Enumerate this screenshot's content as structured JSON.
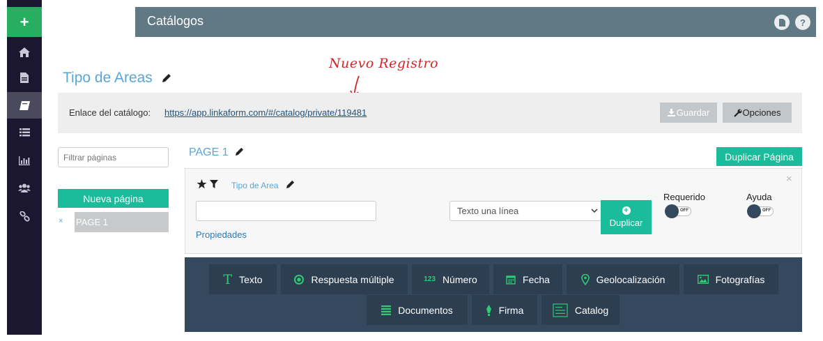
{
  "topbar": {
    "title": "Catálogos",
    "icons": [
      "file-icon",
      "help-icon"
    ],
    "help_label": "?"
  },
  "sidebar": {
    "add_label": "+",
    "items": [
      "home-icon",
      "document-icon",
      "book-icon",
      "list-icon",
      "chart-icon",
      "users-icon",
      "link-icon"
    ],
    "active_item": "book-icon"
  },
  "catalog": {
    "title": "Tipo de Areas"
  },
  "annotation": {
    "text": "Nuevo Registro"
  },
  "linkbar": {
    "label": "Enlace del catálogo:",
    "url": "https://app.linkaform.com/#/catalog/private/119481",
    "save_label": "Guardar",
    "options_label": "Opciones"
  },
  "pages_panel": {
    "filter_placeholder": "Filtrar páginas",
    "new_page_label": "Nueva página",
    "remove_label": "×",
    "pages": [
      "PAGE 1"
    ]
  },
  "page": {
    "title": "PAGE 1",
    "duplicate_label": "Duplicar Página"
  },
  "field": {
    "name": "Tipo de Area",
    "input_value": "",
    "type": "Texto una línea",
    "duplicate_label": "Duplicar",
    "required_label": "Requerido",
    "help_label": "Ayuda",
    "toggle_text": "OFF",
    "properties_label": "Propiedades",
    "close_label": "×"
  },
  "palette": {
    "items": [
      {
        "label": "Texto",
        "icon": "text-icon"
      },
      {
        "label": "Respuesta múltiple",
        "icon": "radio-icon"
      },
      {
        "label": "Número",
        "icon": "number-icon"
      },
      {
        "label": "Fecha",
        "icon": "calendar-icon"
      },
      {
        "label": "Geolocalización",
        "icon": "map-pin-icon"
      },
      {
        "label": "Fotografías",
        "icon": "image-icon"
      },
      {
        "label": "Documentos",
        "icon": "documents-icon"
      },
      {
        "label": "Firma",
        "icon": "pen-icon"
      },
      {
        "label": "Catalog",
        "icon": "catalog-icon"
      }
    ],
    "number_icon_text": "123"
  },
  "colors": {
    "accent": "#1abc9c",
    "sidebar": "#1b1730",
    "topbar": "#607985",
    "palette_bg": "#34495e",
    "annotation": "#d0262c"
  }
}
